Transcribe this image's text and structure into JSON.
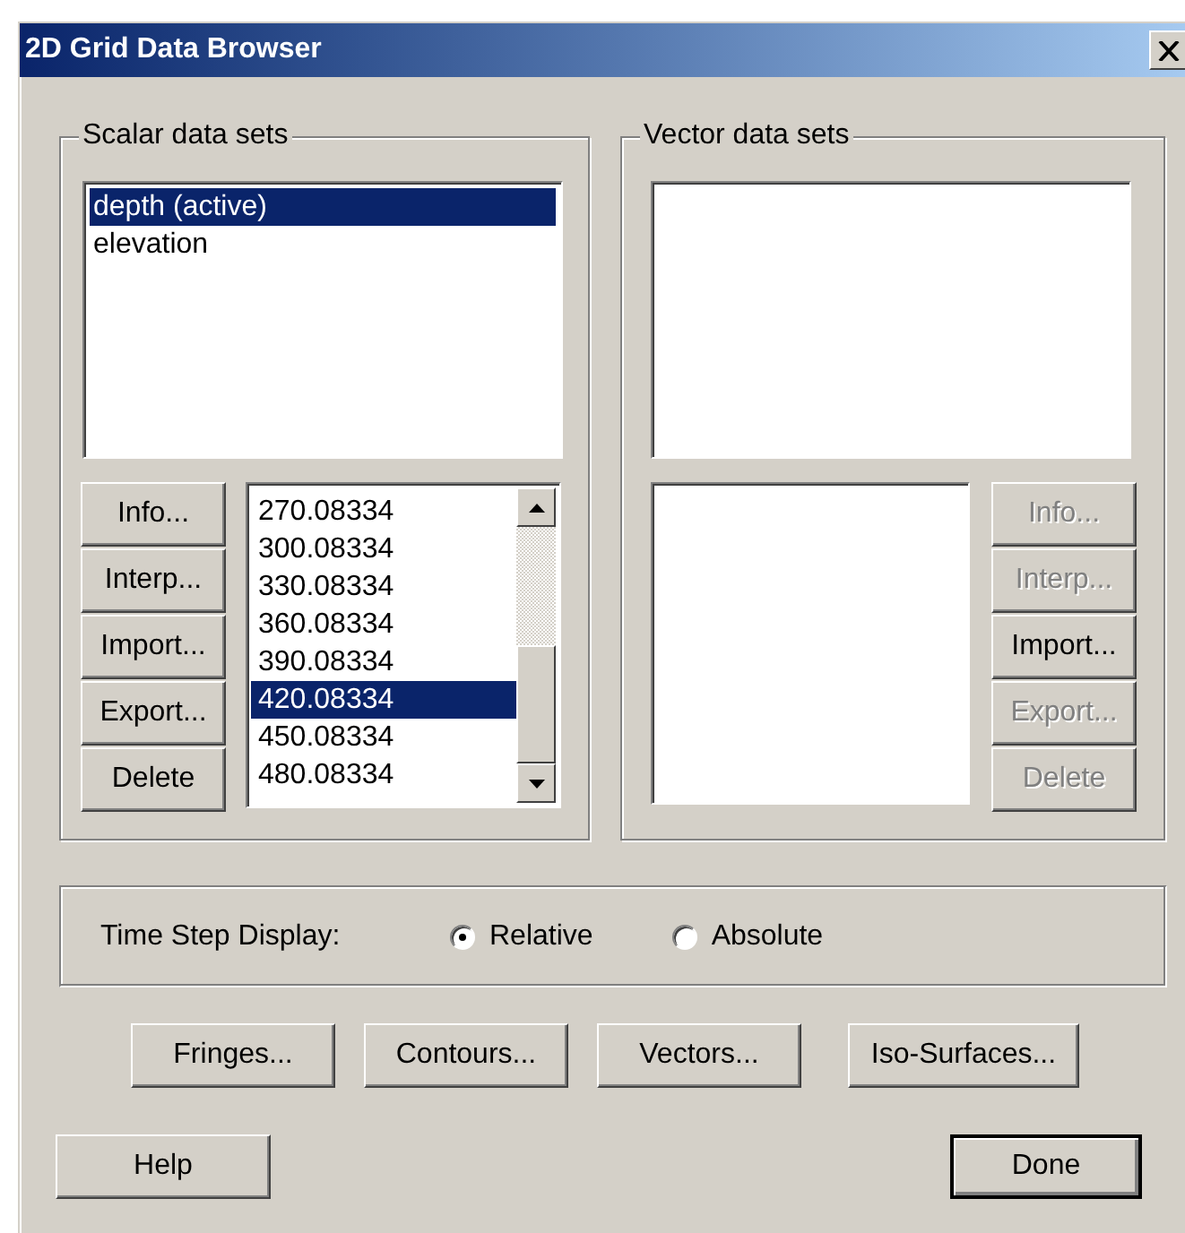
{
  "window": {
    "title": "2D Grid Data Browser"
  },
  "scalar_data_sets": {
    "title": "Scalar data sets",
    "items": [
      {
        "label": "depth (active)",
        "selected": true
      },
      {
        "label": "elevation",
        "selected": false
      }
    ],
    "buttons": [
      {
        "label": "Info...",
        "disabled": false
      },
      {
        "label": "Interp...",
        "disabled": false
      },
      {
        "label": "Import...",
        "disabled": false
      },
      {
        "label": "Export...",
        "disabled": false
      },
      {
        "label": "Delete",
        "disabled": false
      }
    ],
    "time_steps": [
      {
        "label": "270.08334",
        "selected": false
      },
      {
        "label": "300.08334",
        "selected": false
      },
      {
        "label": "330.08334",
        "selected": false
      },
      {
        "label": "360.08334",
        "selected": false
      },
      {
        "label": "390.08334",
        "selected": false
      },
      {
        "label": "420.08334",
        "selected": true
      },
      {
        "label": "450.08334",
        "selected": false
      },
      {
        "label": "480.08334",
        "selected": false
      }
    ]
  },
  "vector_data_sets": {
    "title": "Vector data sets",
    "buttons": [
      {
        "label": "Info...",
        "disabled": true
      },
      {
        "label": "Interp...",
        "disabled": true
      },
      {
        "label": "Import...",
        "disabled": false
      },
      {
        "label": "Export...",
        "disabled": true
      },
      {
        "label": "Delete",
        "disabled": true
      }
    ]
  },
  "time_step_display": {
    "label": "Time Step Display:",
    "options": [
      {
        "label": "Relative",
        "selected": true
      },
      {
        "label": "Absolute",
        "selected": false
      }
    ]
  },
  "plot_buttons": [
    "Fringes...",
    "Contours...",
    "Vectors...",
    "Iso-Surfaces..."
  ],
  "help_button": "Help",
  "done_button": {
    "label": "Done",
    "default": true
  }
}
